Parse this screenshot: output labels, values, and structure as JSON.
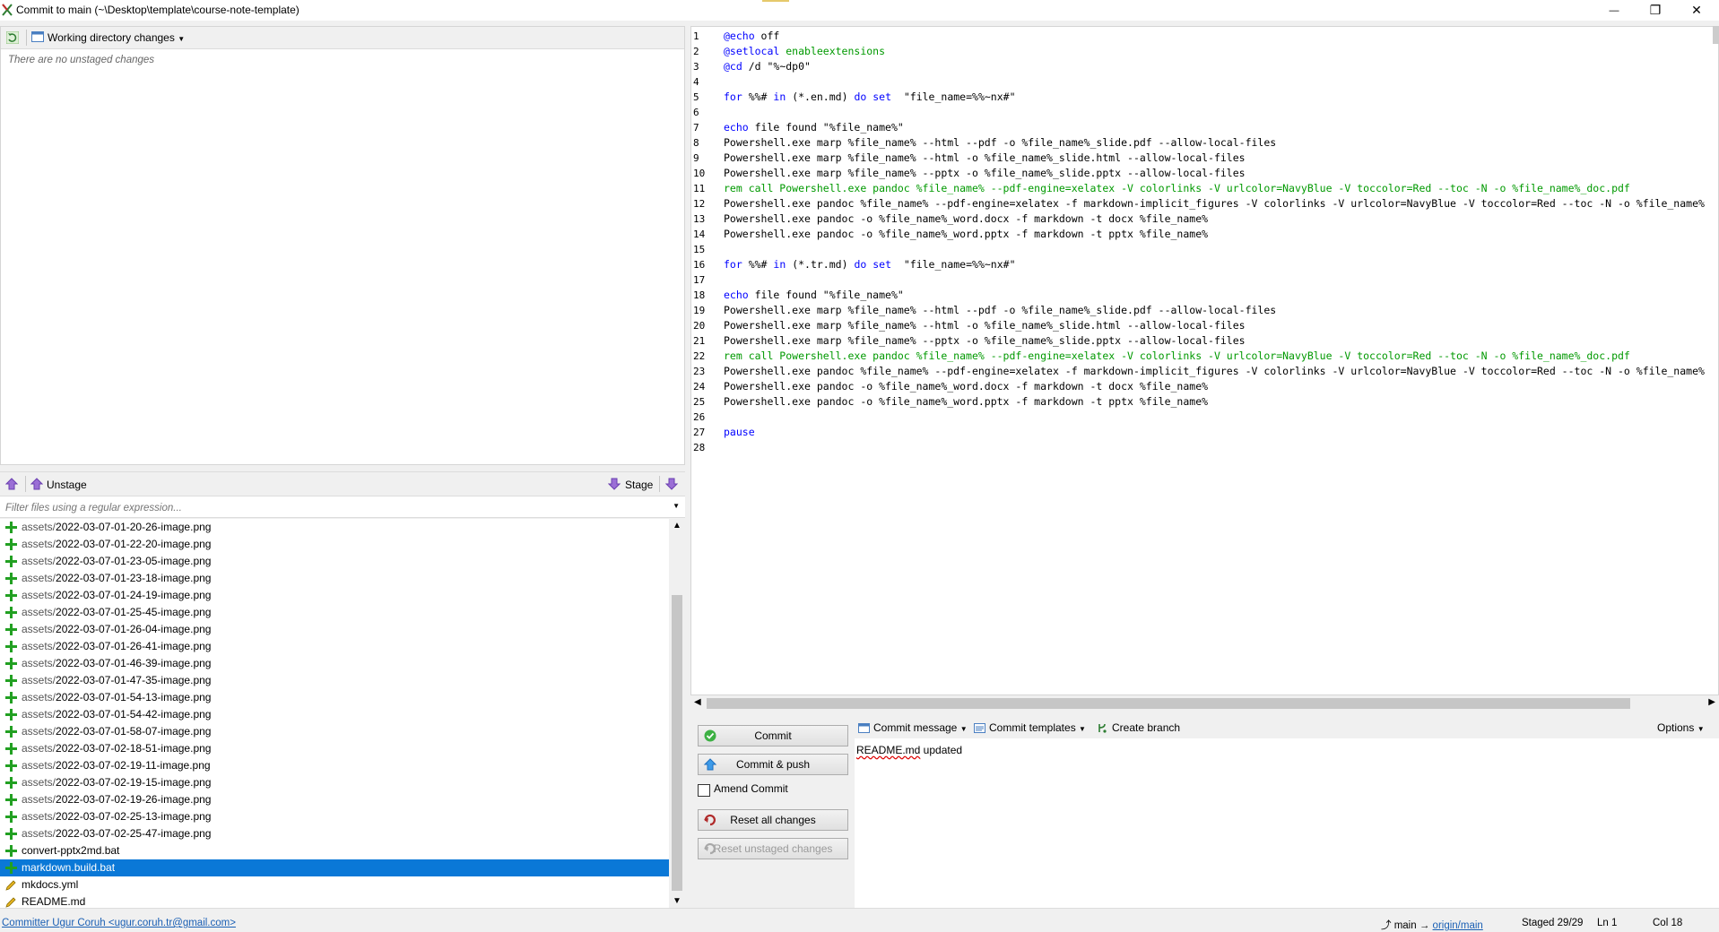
{
  "window": {
    "title": "Commit to main (~\\Desktop\\template\\course-note-template)",
    "minimize_glyph": "—",
    "restore_glyph": "❐",
    "close_glyph": "✕"
  },
  "unstaged": {
    "view_label": "Working directory changes",
    "empty_text": "There are no unstaged changes"
  },
  "stagebar": {
    "unstage_label": "Unstage",
    "stage_label": "Stage"
  },
  "filter": {
    "placeholder": "Filter files using a regular expression..."
  },
  "files": [
    {
      "dir": "assets/",
      "name": "2022-03-07-01-20-26-image.png",
      "status": "added"
    },
    {
      "dir": "assets/",
      "name": "2022-03-07-01-22-20-image.png",
      "status": "added"
    },
    {
      "dir": "assets/",
      "name": "2022-03-07-01-23-05-image.png",
      "status": "added"
    },
    {
      "dir": "assets/",
      "name": "2022-03-07-01-23-18-image.png",
      "status": "added"
    },
    {
      "dir": "assets/",
      "name": "2022-03-07-01-24-19-image.png",
      "status": "added"
    },
    {
      "dir": "assets/",
      "name": "2022-03-07-01-25-45-image.png",
      "status": "added"
    },
    {
      "dir": "assets/",
      "name": "2022-03-07-01-26-04-image.png",
      "status": "added"
    },
    {
      "dir": "assets/",
      "name": "2022-03-07-01-26-41-image.png",
      "status": "added"
    },
    {
      "dir": "assets/",
      "name": "2022-03-07-01-46-39-image.png",
      "status": "added"
    },
    {
      "dir": "assets/",
      "name": "2022-03-07-01-47-35-image.png",
      "status": "added"
    },
    {
      "dir": "assets/",
      "name": "2022-03-07-01-54-13-image.png",
      "status": "added"
    },
    {
      "dir": "assets/",
      "name": "2022-03-07-01-54-42-image.png",
      "status": "added"
    },
    {
      "dir": "assets/",
      "name": "2022-03-07-01-58-07-image.png",
      "status": "added"
    },
    {
      "dir": "assets/",
      "name": "2022-03-07-02-18-51-image.png",
      "status": "added"
    },
    {
      "dir": "assets/",
      "name": "2022-03-07-02-19-11-image.png",
      "status": "added"
    },
    {
      "dir": "assets/",
      "name": "2022-03-07-02-19-15-image.png",
      "status": "added"
    },
    {
      "dir": "assets/",
      "name": "2022-03-07-02-19-26-image.png",
      "status": "added"
    },
    {
      "dir": "assets/",
      "name": "2022-03-07-02-25-13-image.png",
      "status": "added"
    },
    {
      "dir": "assets/",
      "name": "2022-03-07-02-25-47-image.png",
      "status": "added"
    },
    {
      "dir": "",
      "name": "convert-pptx2md.bat",
      "status": "added"
    },
    {
      "dir": "",
      "name": "markdown.build.bat",
      "status": "added",
      "selected": true
    },
    {
      "dir": "",
      "name": "mkdocs.yml",
      "status": "modified"
    },
    {
      "dir": "",
      "name": "README.md",
      "status": "modified"
    }
  ],
  "code_lines": [
    {
      "n": "1",
      "parts": [
        [
          "kw",
          "@echo"
        ],
        [
          "",
          " off"
        ]
      ]
    },
    {
      "n": "2",
      "parts": [
        [
          "kw",
          "@setlocal"
        ],
        [
          "",
          " "
        ],
        [
          "cm",
          "enableextensions"
        ]
      ]
    },
    {
      "n": "3",
      "parts": [
        [
          "kw",
          "@cd"
        ],
        [
          "",
          " /d \"%~dp0\""
        ]
      ]
    },
    {
      "n": "4",
      "parts": []
    },
    {
      "n": "5",
      "parts": [
        [
          "kw",
          "for"
        ],
        [
          "",
          " %%# "
        ],
        [
          "kw",
          "in"
        ],
        [
          "",
          " (*.en.md) "
        ],
        [
          "kw",
          "do"
        ],
        [
          "",
          " "
        ],
        [
          "kw",
          "set"
        ],
        [
          "",
          "  \"file_name=%%~nx#\""
        ]
      ]
    },
    {
      "n": "6",
      "parts": []
    },
    {
      "n": "7",
      "parts": [
        [
          "kw",
          "echo"
        ],
        [
          "",
          " file found \"%file_name%\""
        ]
      ]
    },
    {
      "n": "8",
      "parts": [
        [
          "",
          "Powershell.exe marp %file_name% --html --pdf -o %file_name%_slide.pdf --allow-local-files"
        ]
      ]
    },
    {
      "n": "9",
      "parts": [
        [
          "",
          "Powershell.exe marp %file_name% --html -o %file_name%_slide.html --allow-local-files"
        ]
      ]
    },
    {
      "n": "10",
      "parts": [
        [
          "",
          "Powershell.exe marp %file_name% --pptx -o %file_name%_slide.pptx --allow-local-files"
        ]
      ]
    },
    {
      "n": "11",
      "parts": [
        [
          "cm",
          "rem call Powershell.exe pandoc %file_name% --pdf-engine=xelatex -V colorlinks -V urlcolor=NavyBlue -V toccolor=Red --toc -N -o %file_name%_doc.pdf"
        ]
      ]
    },
    {
      "n": "12",
      "parts": [
        [
          "",
          "Powershell.exe pandoc %file_name% --pdf-engine=xelatex -f markdown-implicit_figures -V colorlinks -V urlcolor=NavyBlue -V toccolor=Red --toc -N -o %file_name%"
        ]
      ]
    },
    {
      "n": "13",
      "parts": [
        [
          "",
          "Powershell.exe pandoc -o %file_name%_word.docx -f markdown -t docx %file_name%"
        ]
      ]
    },
    {
      "n": "14",
      "parts": [
        [
          "",
          "Powershell.exe pandoc -o %file_name%_word.pptx -f markdown -t pptx %file_name%"
        ]
      ]
    },
    {
      "n": "15",
      "parts": []
    },
    {
      "n": "16",
      "parts": [
        [
          "kw",
          "for"
        ],
        [
          "",
          " %%# "
        ],
        [
          "kw",
          "in"
        ],
        [
          "",
          " (*.tr.md) "
        ],
        [
          "kw",
          "do"
        ],
        [
          "",
          " "
        ],
        [
          "kw",
          "set"
        ],
        [
          "",
          "  \"file_name=%%~nx#\""
        ]
      ]
    },
    {
      "n": "17",
      "parts": []
    },
    {
      "n": "18",
      "parts": [
        [
          "kw",
          "echo"
        ],
        [
          "",
          " file found \"%file_name%\""
        ]
      ]
    },
    {
      "n": "19",
      "parts": [
        [
          "",
          "Powershell.exe marp %file_name% --html --pdf -o %file_name%_slide.pdf --allow-local-files"
        ]
      ]
    },
    {
      "n": "20",
      "parts": [
        [
          "",
          "Powershell.exe marp %file_name% --html -o %file_name%_slide.html --allow-local-files"
        ]
      ]
    },
    {
      "n": "21",
      "parts": [
        [
          "",
          "Powershell.exe marp %file_name% --pptx -o %file_name%_slide.pptx --allow-local-files"
        ]
      ]
    },
    {
      "n": "22",
      "parts": [
        [
          "cm",
          "rem call Powershell.exe pandoc %file_name% --pdf-engine=xelatex -V colorlinks -V urlcolor=NavyBlue -V toccolor=Red --toc -N -o %file_name%_doc.pdf"
        ]
      ]
    },
    {
      "n": "23",
      "parts": [
        [
          "",
          "Powershell.exe pandoc %file_name% --pdf-engine=xelatex -f markdown-implicit_figures -V colorlinks -V urlcolor=NavyBlue -V toccolor=Red --toc -N -o %file_name%"
        ]
      ]
    },
    {
      "n": "24",
      "parts": [
        [
          "",
          "Powershell.exe pandoc -o %file_name%_word.docx -f markdown -t docx %file_name%"
        ]
      ]
    },
    {
      "n": "25",
      "parts": [
        [
          "",
          "Powershell.exe pandoc -o %file_name%_word.pptx -f markdown -t pptx %file_name%"
        ]
      ]
    },
    {
      "n": "26",
      "parts": []
    },
    {
      "n": "27",
      "parts": [
        [
          "kw",
          "pause"
        ]
      ]
    },
    {
      "n": "28",
      "parts": []
    }
  ],
  "commit_buttons": {
    "commit": "Commit",
    "commit_push": "Commit & push",
    "amend": "Amend Commit",
    "reset_all": "Reset all changes",
    "reset_unstaged": "Reset unstaged changes"
  },
  "commit_toolbar": {
    "commit_message": "Commit message",
    "commit_templates": "Commit templates",
    "create_branch": "Create branch",
    "options": "Options"
  },
  "commit_message": {
    "word1": "README.md",
    "rest": " updated"
  },
  "statusbar": {
    "committer": "Committer Ugur Coruh <ugur.coruh.tr@gmail.com>",
    "branch": "main",
    "arrow": "→",
    "remote": "origin/main",
    "staged_label": "Staged",
    "staged_value": "29/29",
    "ln_label": "Ln",
    "ln_value": "1",
    "col_label": "Col",
    "col_value": "18"
  },
  "colors": {
    "selection": "#0a78d7",
    "keyword": "#0000ff",
    "comment": "#009900",
    "added_icon": "#22a022",
    "link": "#1a5fb4"
  }
}
